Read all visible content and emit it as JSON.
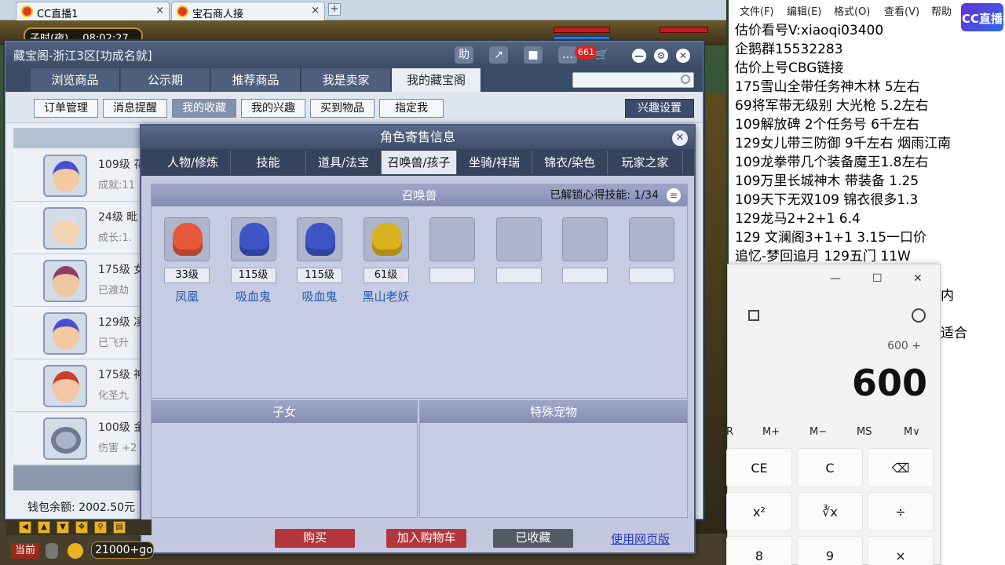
{
  "browser": {
    "tabs": [
      {
        "label": "CC直播1"
      },
      {
        "label": "宝石商人接"
      }
    ],
    "close_glyph": "×",
    "new_tab_glyph": "+"
  },
  "game": {
    "clock_label": "子时(夜)",
    "clock_time": "08:02:27",
    "toolbar_current": "当前",
    "coins": "21000+gold"
  },
  "main_window": {
    "title": "藏宝阁-浙江3区[功成名就]",
    "header_buttons": {
      "help": "助",
      "share": "↗",
      "record": "■",
      "chat": "…"
    },
    "chat_badge": "661",
    "nav_tabs": [
      "浏览商品",
      "公示期",
      "推荐商品",
      "我是卖家",
      "我的藏宝阁"
    ],
    "active_nav": "我的藏宝阁",
    "sub_tabs": [
      "订单管理",
      "消息提醒",
      "我的收藏",
      "我的兴趣",
      "买到物品",
      "指定我"
    ],
    "active_sub": "我的收藏",
    "pref_button": "兴趣设置",
    "list": [
      {
        "level": "109级 花",
        "sub": "成就:11"
      },
      {
        "level": "24级 毗",
        "sub": "成长:1."
      },
      {
        "level": "175级 女",
        "sub": "已渡劫"
      },
      {
        "level": "129级 凌",
        "sub": "已飞升"
      },
      {
        "level": "175级 神",
        "sub": "化圣九"
      },
      {
        "level": "100级 金",
        "sub": "伤害 +2"
      }
    ],
    "wallet": "钱包余额: 2002.50元"
  },
  "dialog": {
    "title": "角色寄售信息",
    "close_glyph": "✕",
    "tabs": [
      "人物/修炼",
      "技能",
      "道具/法宝",
      "召唤兽/孩子",
      "坐骑/祥瑞",
      "锦衣/染色",
      "玩家之家"
    ],
    "active_tab": "召唤兽/孩子",
    "pet_section_title": "召唤兽",
    "pet_skill_info": "已解锁心得技能: 1/34",
    "pets": [
      {
        "level": "33级",
        "name": "凤凰",
        "color": "#e7573a"
      },
      {
        "level": "115级",
        "name": "吸血鬼",
        "color": "#3b56c4"
      },
      {
        "level": "115级",
        "name": "吸血鬼",
        "color": "#3b56c4"
      },
      {
        "level": "61级",
        "name": "黑山老妖",
        "color": "#d9b21f"
      }
    ],
    "empty_slots": 4,
    "children_title": "子女",
    "special_title": "特殊宠物",
    "actions": {
      "buy": "购买",
      "add_cart": "加入购物车",
      "collected": "已收藏",
      "web": "使用网页版"
    }
  },
  "notepad": {
    "menu": [
      "文件(F)",
      "编辑(E)",
      "格式(O)",
      "查看(V)",
      "帮助"
    ],
    "logo": "CC直播",
    "lines": [
      "估价看号V:xiaoqi03400",
      "企鹅群15532283",
      "估价上号CBG链接",
      "175雪山全带任务神木林 5左右",
      "69将军带无级别 大光枪 5.2左右",
      "109解放碑 2个任务号 6千左右",
      "129女儿带三防御 9千左右 烟雨江南",
      "109龙拳带几个装备魔王1.8左右",
      "109万里长城神木 带装备  1.25",
      "109天下无双109 锦衣很多1.3",
      "129龙马2+2+1  6.4",
      "129 文澜阁3+1+1    3.15一口价",
      "追忆-梦回追月 129五门 11W"
    ],
    "partial_right_1": "内",
    "partial_right_2": "适合"
  },
  "calculator": {
    "expression": "600 +",
    "display": "600",
    "memory": [
      "R",
      "M+",
      "M−",
      "MS",
      "M∨"
    ],
    "keys_row1": [
      "CE",
      "C",
      "⌫"
    ],
    "keys_row2": [
      "x²",
      "∛x",
      "÷"
    ],
    "keys_row3": [
      "8",
      "9",
      "×"
    ],
    "win_ctrl": [
      "—",
      "☐",
      "✕"
    ]
  }
}
